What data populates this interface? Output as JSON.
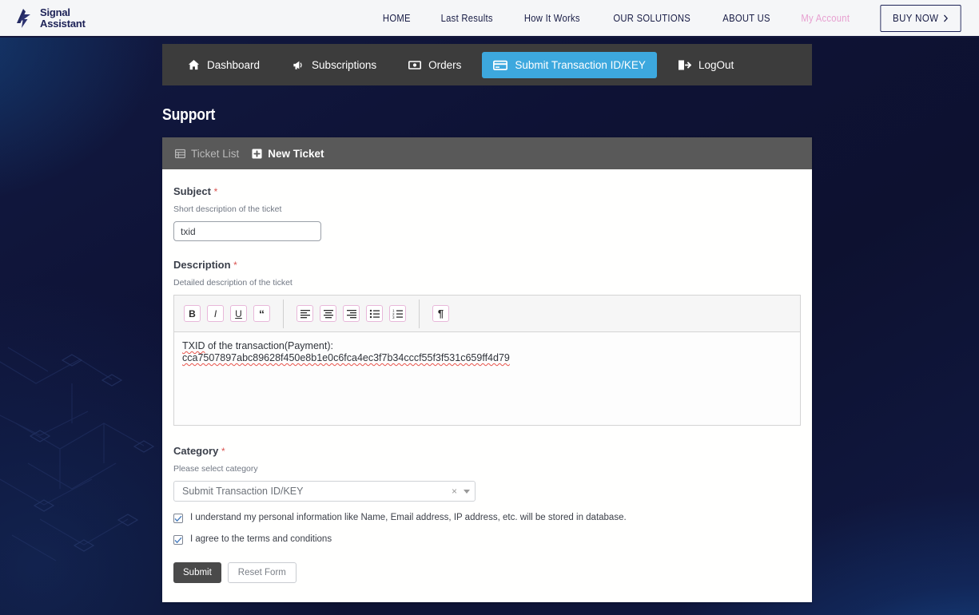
{
  "header": {
    "logo": {
      "icon": "lightning-a-logo",
      "line1": "Signal",
      "line2": "Assistant"
    },
    "nav": [
      {
        "label": "HOME",
        "name": "nav-home",
        "pink": false
      },
      {
        "label": "Last Results",
        "name": "nav-last-results",
        "pink": false
      },
      {
        "label": "How It Works",
        "name": "nav-how-it-works",
        "pink": false
      },
      {
        "label": "OUR SOLUTIONS",
        "name": "nav-our-solutions",
        "pink": false
      },
      {
        "label": "ABOUT US",
        "name": "nav-about-us",
        "pink": false
      },
      {
        "label": "My Account",
        "name": "nav-my-account",
        "pink": true
      }
    ],
    "buy_now": {
      "label": "BUY NOW",
      "chevron": "chevron-right-icon"
    },
    "colors": {
      "bar_bg": "#f5f6f8",
      "text": "#181c45",
      "accent_pink": "#e79fd0"
    }
  },
  "tabstrip": {
    "bg": "#3c3c3c",
    "active_bg": "#3da8de",
    "items": [
      {
        "label": "Dashboard",
        "icon": "home-icon",
        "name": "tab-dashboard",
        "active": false
      },
      {
        "label": "Subscriptions",
        "icon": "megaphone-icon",
        "name": "tab-subscriptions",
        "active": false
      },
      {
        "label": "Orders",
        "icon": "money-bill-icon",
        "name": "tab-orders",
        "active": false
      },
      {
        "label": "Submit Transaction ID/KEY",
        "icon": "credit-card-icon",
        "name": "tab-submit-transaction",
        "active": true
      },
      {
        "label": "LogOut",
        "icon": "sign-out-icon",
        "name": "tab-logout",
        "active": false
      }
    ]
  },
  "page": {
    "title": "Support"
  },
  "card": {
    "header_bg": "#595959",
    "tabs": [
      {
        "label": "Ticket List",
        "icon": "table-list-icon",
        "name": "card-tab-ticket-list",
        "active": false
      },
      {
        "label": "New Ticket",
        "icon": "plus-square-icon",
        "name": "card-tab-new-ticket",
        "active": true
      }
    ]
  },
  "form": {
    "subject": {
      "label": "Subject",
      "required_mark": "*",
      "help": "Short description of the ticket",
      "value": "txid",
      "placeholder": ""
    },
    "description": {
      "label": "Description",
      "required_mark": "*",
      "help": "Detailed description of the ticket",
      "line1_prefix": "TXID",
      "line1_rest": " of the transaction(Payment):",
      "line2": "cca7507897abc89628f450e8b1e0c6fca4ec3f7b34cccf55f3f531c659ff4d79",
      "toolbar": [
        {
          "name": "bold-icon",
          "glyph": "B",
          "title": "Bold"
        },
        {
          "name": "italic-icon",
          "glyph": "I",
          "title": "Italic"
        },
        {
          "name": "underline-icon",
          "glyph": "U",
          "title": "Underline"
        },
        {
          "name": "blockquote-icon",
          "glyph": "“",
          "title": "Blockquote"
        },
        {
          "name": "align-left-icon",
          "glyph": "",
          "title": "Align left"
        },
        {
          "name": "align-center-icon",
          "glyph": "",
          "title": "Align center"
        },
        {
          "name": "align-right-icon",
          "glyph": "",
          "title": "Align right"
        },
        {
          "name": "bullet-list-icon",
          "glyph": "",
          "title": "Bulleted list"
        },
        {
          "name": "ordered-list-icon",
          "glyph": "",
          "title": "Numbered list"
        },
        {
          "name": "text-direction-icon",
          "glyph": "¶",
          "title": "Text direction"
        }
      ]
    },
    "category": {
      "label": "Category",
      "required_mark": "*",
      "help": "Please select category",
      "value": "Submit Transaction ID/KEY",
      "clear_glyph": "×",
      "caret": "caret-down-icon"
    },
    "checkboxes": [
      {
        "name": "checkbox-data-consent",
        "label": "I understand my personal information like Name, Email address, IP address, etc. will be stored in database.",
        "checked": true
      },
      {
        "name": "checkbox-terms",
        "label": "I agree to the terms and conditions",
        "checked": true
      }
    ],
    "buttons": {
      "submit": "Submit",
      "reset": "Reset Form"
    }
  }
}
